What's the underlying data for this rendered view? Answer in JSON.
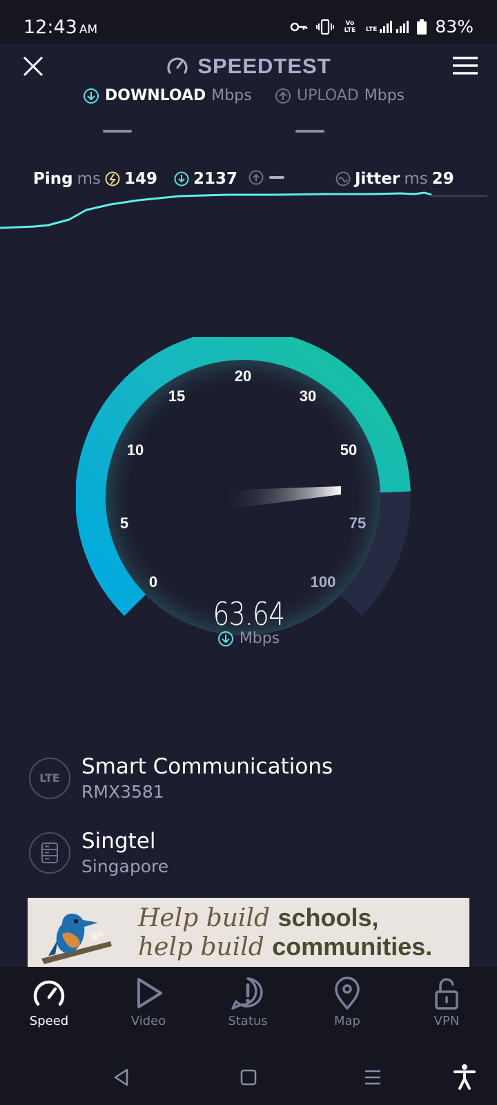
{
  "status_bar": {
    "time": "12:43",
    "ampm": "AM",
    "volte": "Vo LTE",
    "lte": "LTE",
    "battery": "83%"
  },
  "header": {
    "title": "SPEEDTEST",
    "close_icon": "close-icon",
    "menu_icon": "hamburger-menu-icon"
  },
  "tabs": {
    "download_label": "DOWNLOAD",
    "download_unit": "Mbps",
    "upload_label": "UPLOAD",
    "upload_unit": "Mbps"
  },
  "stats": {
    "ping_label": "Ping",
    "ping_unit": "ms",
    "ping_value": "149",
    "download_ping": "2137",
    "jitter_label": "Jitter",
    "jitter_unit": "ms",
    "jitter_value": "29"
  },
  "gauge": {
    "ticks": [
      "0",
      "5",
      "10",
      "15",
      "20",
      "30",
      "50",
      "75",
      "100"
    ],
    "value": "63.64",
    "unit": "Mbps",
    "colors": {
      "start": "#00a8e0",
      "end": "#17c29a",
      "track": "#262b44"
    }
  },
  "connection": {
    "provider_badge": "LTE",
    "provider": "Smart Communications",
    "device": "RMX3581",
    "server": "Singtel",
    "location": "Singapore"
  },
  "ad": {
    "line1_script": "Help build",
    "line1_bold": "schools,",
    "line2_script": "help build",
    "line2_bold": "communities."
  },
  "bottom_nav": [
    {
      "label": "Speed",
      "icon": "speedometer-icon",
      "active": true
    },
    {
      "label": "Video",
      "icon": "play-icon",
      "active": false
    },
    {
      "label": "Status",
      "icon": "alert-icon",
      "active": false
    },
    {
      "label": "Map",
      "icon": "map-pin-icon",
      "active": false
    },
    {
      "label": "VPN",
      "icon": "unlock-icon",
      "active": false
    }
  ]
}
